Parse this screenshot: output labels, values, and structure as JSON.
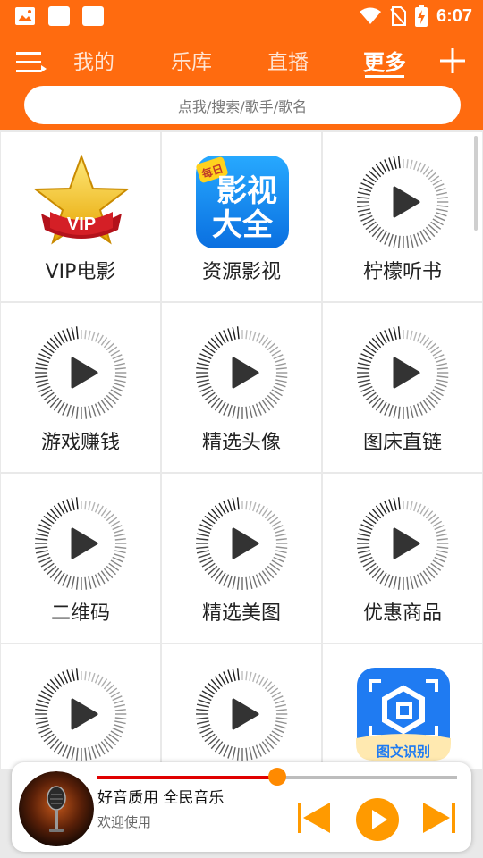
{
  "status_bar": {
    "time": "6:07"
  },
  "nav": {
    "tabs": [
      {
        "label": "我的",
        "active": false
      },
      {
        "label": "乐库",
        "active": false
      },
      {
        "label": "直播",
        "active": false
      },
      {
        "label": "更多",
        "active": true
      }
    ]
  },
  "search": {
    "placeholder": "点我/搜索/歌手/歌名"
  },
  "grid": {
    "items": [
      {
        "label": "VIP电影",
        "icon": "vip-star-icon"
      },
      {
        "label": "资源影视",
        "icon": "movie-app-icon"
      },
      {
        "label": "柠檬听书",
        "icon": "play-disc-icon"
      },
      {
        "label": "游戏赚钱",
        "icon": "play-disc-icon"
      },
      {
        "label": "精选头像",
        "icon": "play-disc-icon"
      },
      {
        "label": "图床直链",
        "icon": "play-disc-icon"
      },
      {
        "label": "二维码",
        "icon": "play-disc-icon"
      },
      {
        "label": "精选美图",
        "icon": "play-disc-icon"
      },
      {
        "label": "优惠商品",
        "icon": "play-disc-icon"
      },
      {
        "label": "",
        "icon": "play-disc-icon"
      },
      {
        "label": "",
        "icon": "play-disc-icon"
      },
      {
        "label": "",
        "icon": "ocr-app-icon"
      }
    ],
    "vip_badge_text": "VIP",
    "movie_app_text": {
      "badge": "每日",
      "line1": "影视",
      "line2": "大全"
    },
    "ocr_app_text": "图文识别"
  },
  "player": {
    "title": "好音质用 全民音乐",
    "subtitle": "欢迎使用",
    "progress": 0.5
  },
  "colors": {
    "accent": "#ff6b0f",
    "progress": "#e00000",
    "control": "#ff9a00"
  }
}
